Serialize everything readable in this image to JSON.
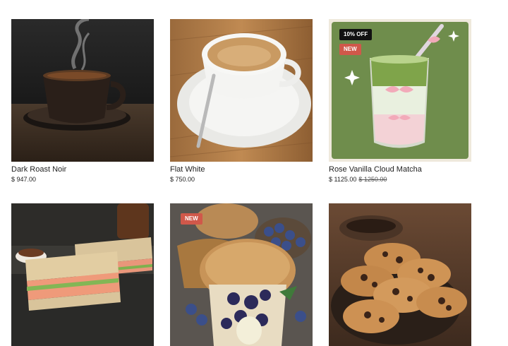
{
  "products": [
    {
      "name": "Dark Roast Noir",
      "price": "$ 947.00",
      "image": "dark-roast-coffee-image"
    },
    {
      "name": "Flat White",
      "price": "$ 750.00",
      "image": "flat-white-coffee-image"
    },
    {
      "name": "Rose Vanilla Cloud Matcha",
      "price": "$ 1125.00",
      "old_price": "$ 1250.00",
      "badges": [
        "10% OFF",
        "NEW"
      ],
      "image": "matcha-drink-image"
    },
    {
      "name": "",
      "image": "sandwich-image"
    },
    {
      "name": "",
      "badges": [
        "NEW"
      ],
      "image": "blueberry-muffin-image"
    },
    {
      "name": "",
      "image": "chocolate-chip-cookies-image"
    }
  ],
  "colors": {
    "new_badge": "#d0584a",
    "discount_badge": "#111111",
    "matcha_bg": "#6f8d4c"
  }
}
